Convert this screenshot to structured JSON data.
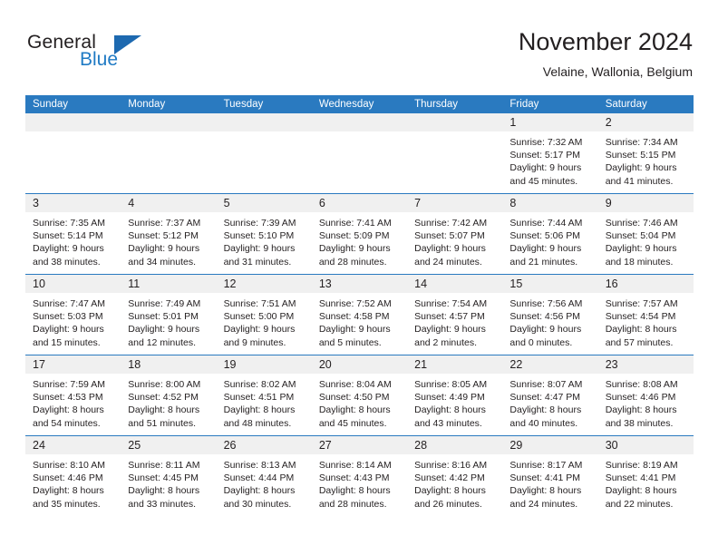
{
  "brand": {
    "name_part1": "General",
    "name_part2": "Blue",
    "logo_icon": "blue-triangle-flag-icon"
  },
  "header": {
    "title": "November 2024",
    "location": "Velaine, Wallonia, Belgium"
  },
  "colors": {
    "header_blue": "#2a7ac0",
    "brand_blue": "#1f7ac4",
    "daynum_band": "#f0f0f0",
    "text": "#231f20"
  },
  "weekdays": [
    "Sunday",
    "Monday",
    "Tuesday",
    "Wednesday",
    "Thursday",
    "Friday",
    "Saturday"
  ],
  "weeks": [
    [
      {
        "day": "",
        "empty": true
      },
      {
        "day": "",
        "empty": true
      },
      {
        "day": "",
        "empty": true
      },
      {
        "day": "",
        "empty": true
      },
      {
        "day": "",
        "empty": true
      },
      {
        "day": "1",
        "sunrise": "Sunrise: 7:32 AM",
        "sunset": "Sunset: 5:17 PM",
        "daylight1": "Daylight: 9 hours",
        "daylight2": "and 45 minutes."
      },
      {
        "day": "2",
        "sunrise": "Sunrise: 7:34 AM",
        "sunset": "Sunset: 5:15 PM",
        "daylight1": "Daylight: 9 hours",
        "daylight2": "and 41 minutes."
      }
    ],
    [
      {
        "day": "3",
        "sunrise": "Sunrise: 7:35 AM",
        "sunset": "Sunset: 5:14 PM",
        "daylight1": "Daylight: 9 hours",
        "daylight2": "and 38 minutes."
      },
      {
        "day": "4",
        "sunrise": "Sunrise: 7:37 AM",
        "sunset": "Sunset: 5:12 PM",
        "daylight1": "Daylight: 9 hours",
        "daylight2": "and 34 minutes."
      },
      {
        "day": "5",
        "sunrise": "Sunrise: 7:39 AM",
        "sunset": "Sunset: 5:10 PM",
        "daylight1": "Daylight: 9 hours",
        "daylight2": "and 31 minutes."
      },
      {
        "day": "6",
        "sunrise": "Sunrise: 7:41 AM",
        "sunset": "Sunset: 5:09 PM",
        "daylight1": "Daylight: 9 hours",
        "daylight2": "and 28 minutes."
      },
      {
        "day": "7",
        "sunrise": "Sunrise: 7:42 AM",
        "sunset": "Sunset: 5:07 PM",
        "daylight1": "Daylight: 9 hours",
        "daylight2": "and 24 minutes."
      },
      {
        "day": "8",
        "sunrise": "Sunrise: 7:44 AM",
        "sunset": "Sunset: 5:06 PM",
        "daylight1": "Daylight: 9 hours",
        "daylight2": "and 21 minutes."
      },
      {
        "day": "9",
        "sunrise": "Sunrise: 7:46 AM",
        "sunset": "Sunset: 5:04 PM",
        "daylight1": "Daylight: 9 hours",
        "daylight2": "and 18 minutes."
      }
    ],
    [
      {
        "day": "10",
        "sunrise": "Sunrise: 7:47 AM",
        "sunset": "Sunset: 5:03 PM",
        "daylight1": "Daylight: 9 hours",
        "daylight2": "and 15 minutes."
      },
      {
        "day": "11",
        "sunrise": "Sunrise: 7:49 AM",
        "sunset": "Sunset: 5:01 PM",
        "daylight1": "Daylight: 9 hours",
        "daylight2": "and 12 minutes."
      },
      {
        "day": "12",
        "sunrise": "Sunrise: 7:51 AM",
        "sunset": "Sunset: 5:00 PM",
        "daylight1": "Daylight: 9 hours",
        "daylight2": "and 9 minutes."
      },
      {
        "day": "13",
        "sunrise": "Sunrise: 7:52 AM",
        "sunset": "Sunset: 4:58 PM",
        "daylight1": "Daylight: 9 hours",
        "daylight2": "and 5 minutes."
      },
      {
        "day": "14",
        "sunrise": "Sunrise: 7:54 AM",
        "sunset": "Sunset: 4:57 PM",
        "daylight1": "Daylight: 9 hours",
        "daylight2": "and 2 minutes."
      },
      {
        "day": "15",
        "sunrise": "Sunrise: 7:56 AM",
        "sunset": "Sunset: 4:56 PM",
        "daylight1": "Daylight: 9 hours",
        "daylight2": "and 0 minutes."
      },
      {
        "day": "16",
        "sunrise": "Sunrise: 7:57 AM",
        "sunset": "Sunset: 4:54 PM",
        "daylight1": "Daylight: 8 hours",
        "daylight2": "and 57 minutes."
      }
    ],
    [
      {
        "day": "17",
        "sunrise": "Sunrise: 7:59 AM",
        "sunset": "Sunset: 4:53 PM",
        "daylight1": "Daylight: 8 hours",
        "daylight2": "and 54 minutes."
      },
      {
        "day": "18",
        "sunrise": "Sunrise: 8:00 AM",
        "sunset": "Sunset: 4:52 PM",
        "daylight1": "Daylight: 8 hours",
        "daylight2": "and 51 minutes."
      },
      {
        "day": "19",
        "sunrise": "Sunrise: 8:02 AM",
        "sunset": "Sunset: 4:51 PM",
        "daylight1": "Daylight: 8 hours",
        "daylight2": "and 48 minutes."
      },
      {
        "day": "20",
        "sunrise": "Sunrise: 8:04 AM",
        "sunset": "Sunset: 4:50 PM",
        "daylight1": "Daylight: 8 hours",
        "daylight2": "and 45 minutes."
      },
      {
        "day": "21",
        "sunrise": "Sunrise: 8:05 AM",
        "sunset": "Sunset: 4:49 PM",
        "daylight1": "Daylight: 8 hours",
        "daylight2": "and 43 minutes."
      },
      {
        "day": "22",
        "sunrise": "Sunrise: 8:07 AM",
        "sunset": "Sunset: 4:47 PM",
        "daylight1": "Daylight: 8 hours",
        "daylight2": "and 40 minutes."
      },
      {
        "day": "23",
        "sunrise": "Sunrise: 8:08 AM",
        "sunset": "Sunset: 4:46 PM",
        "daylight1": "Daylight: 8 hours",
        "daylight2": "and 38 minutes."
      }
    ],
    [
      {
        "day": "24",
        "sunrise": "Sunrise: 8:10 AM",
        "sunset": "Sunset: 4:46 PM",
        "daylight1": "Daylight: 8 hours",
        "daylight2": "and 35 minutes."
      },
      {
        "day": "25",
        "sunrise": "Sunrise: 8:11 AM",
        "sunset": "Sunset: 4:45 PM",
        "daylight1": "Daylight: 8 hours",
        "daylight2": "and 33 minutes."
      },
      {
        "day": "26",
        "sunrise": "Sunrise: 8:13 AM",
        "sunset": "Sunset: 4:44 PM",
        "daylight1": "Daylight: 8 hours",
        "daylight2": "and 30 minutes."
      },
      {
        "day": "27",
        "sunrise": "Sunrise: 8:14 AM",
        "sunset": "Sunset: 4:43 PM",
        "daylight1": "Daylight: 8 hours",
        "daylight2": "and 28 minutes."
      },
      {
        "day": "28",
        "sunrise": "Sunrise: 8:16 AM",
        "sunset": "Sunset: 4:42 PM",
        "daylight1": "Daylight: 8 hours",
        "daylight2": "and 26 minutes."
      },
      {
        "day": "29",
        "sunrise": "Sunrise: 8:17 AM",
        "sunset": "Sunset: 4:41 PM",
        "daylight1": "Daylight: 8 hours",
        "daylight2": "and 24 minutes."
      },
      {
        "day": "30",
        "sunrise": "Sunrise: 8:19 AM",
        "sunset": "Sunset: 4:41 PM",
        "daylight1": "Daylight: 8 hours",
        "daylight2": "and 22 minutes."
      }
    ]
  ]
}
